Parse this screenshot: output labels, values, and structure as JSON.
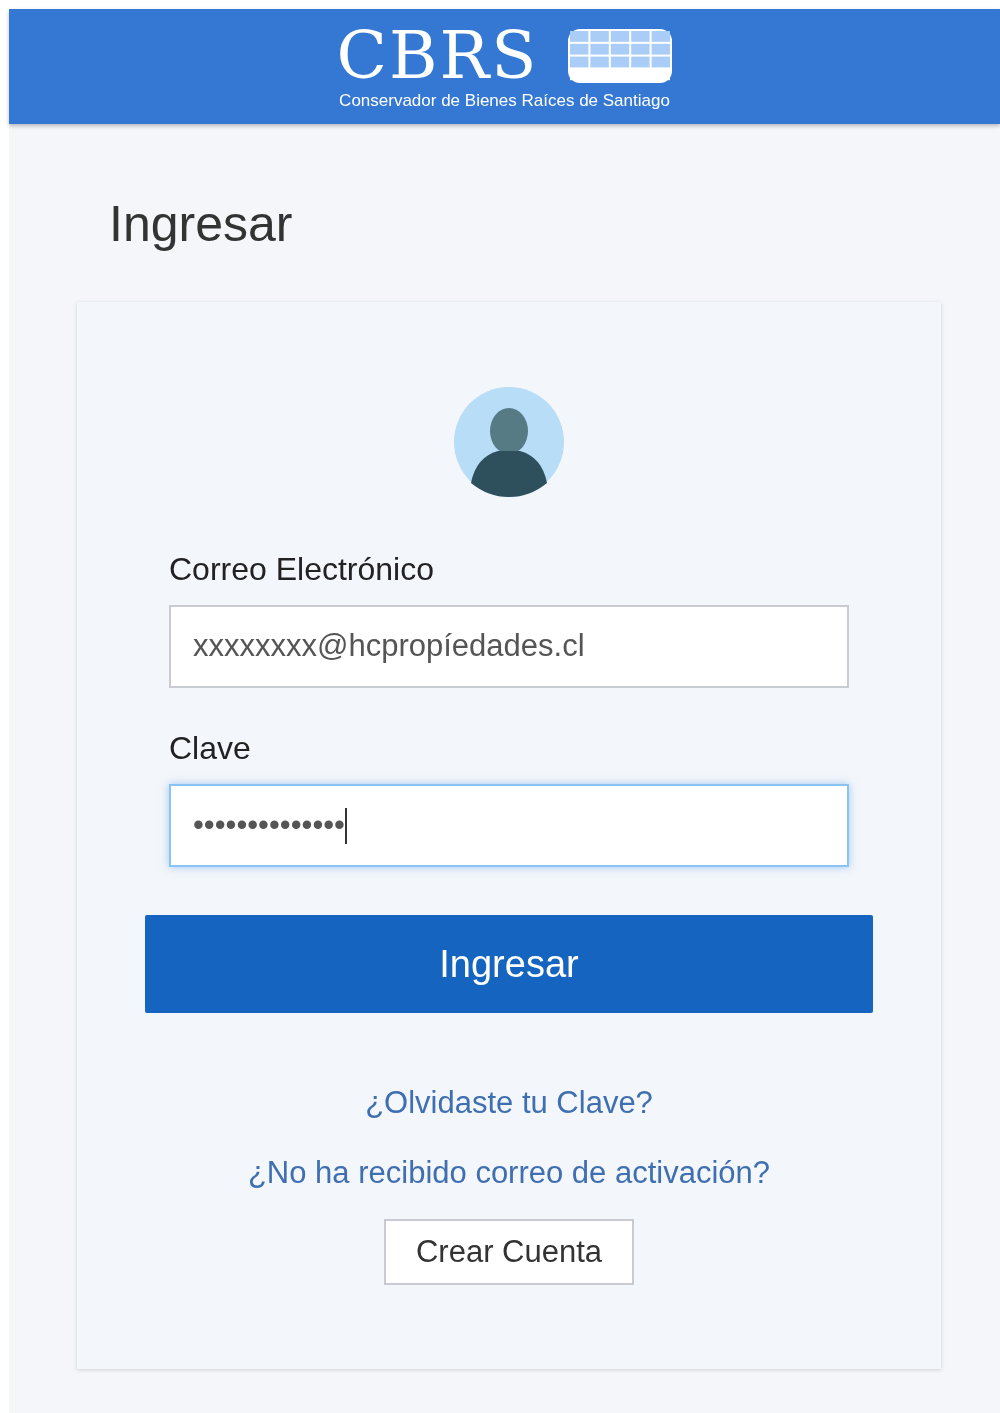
{
  "header": {
    "logo_title": "CBRS",
    "logo_subtitle": "Conservador de Bienes Raíces de Santiago"
  },
  "page_title": "Ingresar",
  "fields": [
    {
      "label": "Correo Electrónico",
      "value": "xxxxxxxx@hcpropíedades.cl",
      "focused": false
    },
    {
      "label": "Clave",
      "value": "••••••••••••••",
      "focused": true
    }
  ],
  "submit_button": "Ingresar",
  "links": [
    "¿Olvidaste tu Clave?",
    "¿No ha recibido correo de activación?"
  ],
  "create_account_button": "Crear Cuenta"
}
